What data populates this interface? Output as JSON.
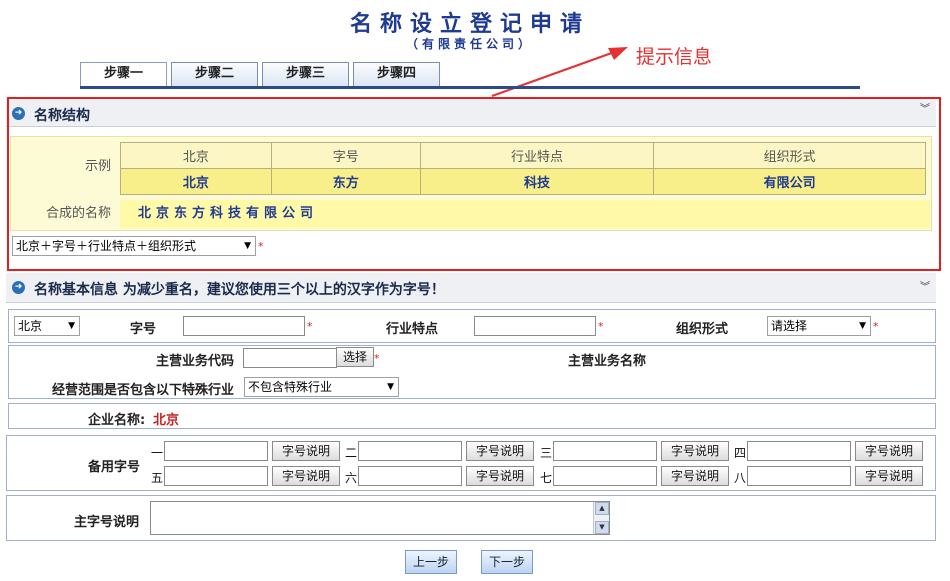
{
  "header": {
    "title": "名称设立登记申请",
    "subtitle": "（有限责任公司）",
    "hint": "提示信息"
  },
  "tabs": [
    {
      "label": "步骤一",
      "active": true
    },
    {
      "label": "步骤二",
      "active": false
    },
    {
      "label": "步骤三",
      "active": false
    },
    {
      "label": "步骤四",
      "active": false
    }
  ],
  "structure": {
    "section_title": "名称结构",
    "example_label": "示例",
    "columns": [
      "北京",
      "字号",
      "行业特点",
      "组织形式"
    ],
    "example_values": [
      "北京",
      "东方",
      "科技",
      "有限公司"
    ],
    "composed_label": "合成的名称",
    "composed_value": "北京东方科技有限公司",
    "pattern_select": "北京＋字号＋行业特点＋组织形式"
  },
  "basic": {
    "section_title": "名称基本信息 为减少重名，建议您使用三个以上的汉字作为字号！",
    "region_select": "北京",
    "zihao_label": "字号",
    "industry_label": "行业特点",
    "org_label": "组织形式",
    "org_select": "请选择",
    "business_code_label": "主营业务代码",
    "select_button": "选择",
    "business_name_label": "主营业务名称",
    "special_label": "经营范围是否包含以下特殊行业",
    "special_select": "不包含特殊行业",
    "enterprise_label": "企业名称:",
    "enterprise_value": "北京"
  },
  "backup": {
    "label": "备用字号",
    "numbers": [
      "一",
      "二",
      "三",
      "四",
      "五",
      "六",
      "七",
      "八"
    ],
    "explain_button": "字号说明"
  },
  "main_explain": {
    "label": "主字号说明"
  },
  "footer": {
    "prev": "上一步",
    "next": "下一步"
  },
  "colors": {
    "title": "#1f3a93",
    "hint": "#e53030",
    "frame": "#e02020",
    "required": "#e02020"
  }
}
